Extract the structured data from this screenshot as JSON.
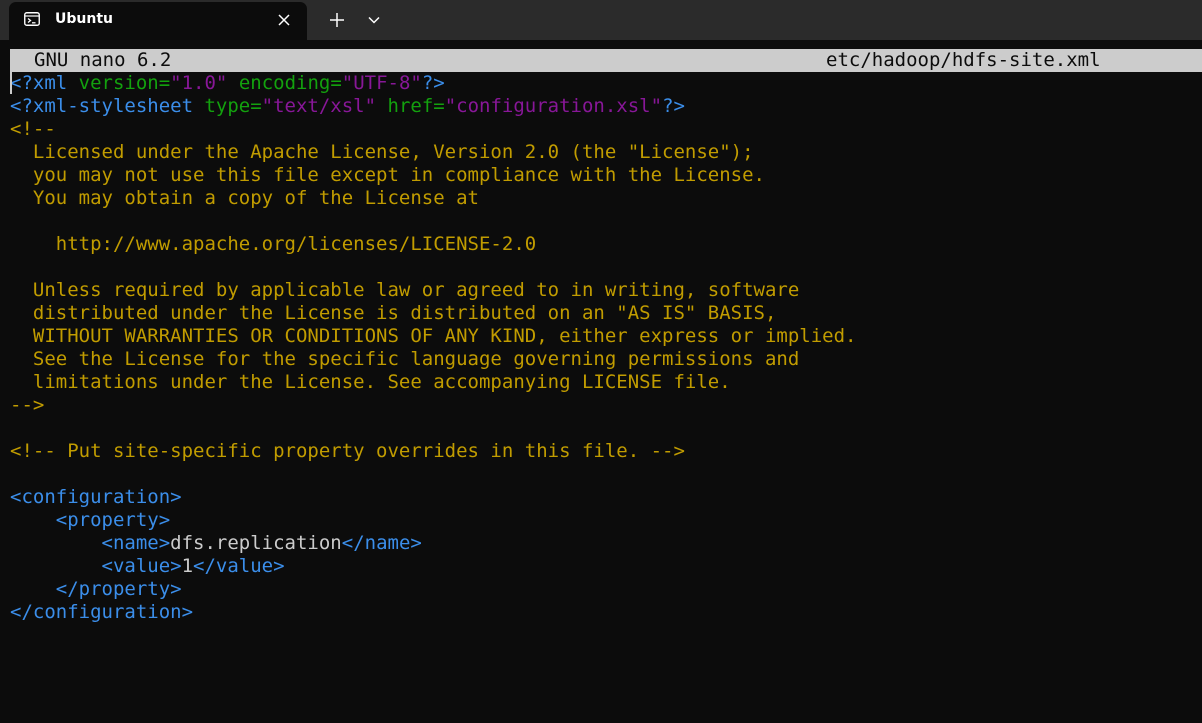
{
  "window": {
    "tab_title": "Ubuntu",
    "tab_icon": "terminal-icon",
    "close_icon": "close-icon",
    "new_tab_icon": "plus-icon",
    "dropdown_icon": "chevron-down-icon"
  },
  "nano": {
    "version": "GNU nano 6.2",
    "filename": "etc/hadoop/hdfs-site.xml"
  },
  "editor": {
    "lines": [
      [
        {
          "t": "pi",
          "v": "<?xml "
        },
        {
          "t": "attr",
          "v": "version="
        },
        {
          "t": "str",
          "v": "\"1.0\""
        },
        {
          "t": "txt",
          "v": " "
        },
        {
          "t": "attr",
          "v": "encoding="
        },
        {
          "t": "str",
          "v": "\"UTF-8\""
        },
        {
          "t": "pi",
          "v": "?>"
        }
      ],
      [
        {
          "t": "pi",
          "v": "<?xml-stylesheet "
        },
        {
          "t": "attr",
          "v": "type="
        },
        {
          "t": "str",
          "v": "\"text/xsl\""
        },
        {
          "t": "txt",
          "v": " "
        },
        {
          "t": "attr",
          "v": "href="
        },
        {
          "t": "str",
          "v": "\"configuration.xsl\""
        },
        {
          "t": "pi",
          "v": "?>"
        }
      ],
      [
        {
          "t": "cmt",
          "v": "<!--"
        }
      ],
      [
        {
          "t": "cmt",
          "v": "  Licensed under the Apache License, Version 2.0 (the \"License\");"
        }
      ],
      [
        {
          "t": "cmt",
          "v": "  you may not use this file except in compliance with the License."
        }
      ],
      [
        {
          "t": "cmt",
          "v": "  You may obtain a copy of the License at"
        }
      ],
      [],
      [
        {
          "t": "cmt",
          "v": "    http://www.apache.org/licenses/LICENSE-2.0"
        }
      ],
      [],
      [
        {
          "t": "cmt",
          "v": "  Unless required by applicable law or agreed to in writing, software"
        }
      ],
      [
        {
          "t": "cmt",
          "v": "  distributed under the License is distributed on an \"AS IS\" BASIS,"
        }
      ],
      [
        {
          "t": "cmt",
          "v": "  WITHOUT WARRANTIES OR CONDITIONS OF ANY KIND, either express or implied."
        }
      ],
      [
        {
          "t": "cmt",
          "v": "  See the License for the specific language governing permissions and"
        }
      ],
      [
        {
          "t": "cmt",
          "v": "  limitations under the License. See accompanying LICENSE file."
        }
      ],
      [
        {
          "t": "cmt",
          "v": "-->"
        }
      ],
      [],
      [
        {
          "t": "cmt",
          "v": "<!-- Put site-specific property overrides in this file. -->"
        }
      ],
      [],
      [
        {
          "t": "tag",
          "v": "<configuration>"
        }
      ],
      [
        {
          "t": "txt",
          "v": "    "
        },
        {
          "t": "tag",
          "v": "<property>"
        }
      ],
      [
        {
          "t": "txt",
          "v": "        "
        },
        {
          "t": "tag",
          "v": "<name>"
        },
        {
          "t": "txt",
          "v": "dfs.replication"
        },
        {
          "t": "tag",
          "v": "</name>"
        }
      ],
      [
        {
          "t": "txt",
          "v": "        "
        },
        {
          "t": "tag",
          "v": "<value>"
        },
        {
          "t": "txt",
          "v": "1"
        },
        {
          "t": "tag",
          "v": "</value>"
        }
      ],
      [
        {
          "t": "txt",
          "v": "    "
        },
        {
          "t": "tag",
          "v": "</property>"
        }
      ],
      [
        {
          "t": "tag",
          "v": "</configuration>"
        }
      ]
    ]
  },
  "colors": {
    "background": "#0c0c0c",
    "titlebar": "#2b2b2b",
    "header_bar": "#cccccc",
    "tag": "#3b8eea",
    "attribute": "#13a10e",
    "string": "#881798",
    "comment": "#c19c00",
    "text": "#cccccc"
  }
}
